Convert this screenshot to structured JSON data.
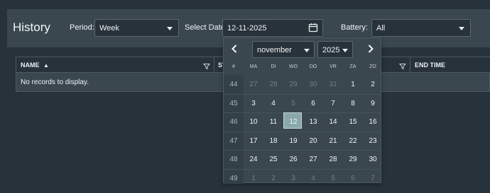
{
  "page": {
    "title": "History"
  },
  "filters": {
    "period_label": "Period:",
    "period_value": "Week",
    "date_label": "Select Date:",
    "date_value": "12-11-2025",
    "battery_label": "Battery:",
    "battery_value": "All"
  },
  "grid": {
    "columns": [
      "NAME",
      "ST",
      "END TIME"
    ],
    "empty_message": "No records to display."
  },
  "calendar": {
    "month": "november",
    "year": "2025",
    "week_header": "#",
    "weekdays": [
      "MA",
      "DI",
      "WO",
      "DO",
      "VR",
      "ZA",
      "ZO"
    ],
    "weeks": [
      {
        "number": "44",
        "days": [
          {
            "d": "27",
            "o": true
          },
          {
            "d": "28",
            "o": true
          },
          {
            "d": "29",
            "o": true
          },
          {
            "d": "30",
            "o": true
          },
          {
            "d": "31",
            "o": true
          },
          {
            "d": "1",
            "o": false
          },
          {
            "d": "2",
            "o": false
          }
        ]
      },
      {
        "number": "45",
        "days": [
          {
            "d": "3",
            "o": false
          },
          {
            "d": "4",
            "o": false
          },
          {
            "d": "5",
            "o": true
          },
          {
            "d": "6",
            "o": false
          },
          {
            "d": "7",
            "o": false
          },
          {
            "d": "8",
            "o": false
          },
          {
            "d": "9",
            "o": false
          }
        ]
      },
      {
        "number": "46",
        "days": [
          {
            "d": "10",
            "o": false
          },
          {
            "d": "11",
            "o": false
          },
          {
            "d": "12",
            "o": false
          },
          {
            "d": "13",
            "o": false
          },
          {
            "d": "14",
            "o": false
          },
          {
            "d": "15",
            "o": false
          },
          {
            "d": "16",
            "o": false
          }
        ]
      },
      {
        "number": "47",
        "days": [
          {
            "d": "17",
            "o": false
          },
          {
            "d": "18",
            "o": false
          },
          {
            "d": "19",
            "o": false
          },
          {
            "d": "20",
            "o": false
          },
          {
            "d": "21",
            "o": false
          },
          {
            "d": "22",
            "o": false
          },
          {
            "d": "23",
            "o": false
          }
        ]
      },
      {
        "number": "48",
        "days": [
          {
            "d": "24",
            "o": false
          },
          {
            "d": "25",
            "o": false
          },
          {
            "d": "26",
            "o": false
          },
          {
            "d": "27",
            "o": false
          },
          {
            "d": "28",
            "o": false
          },
          {
            "d": "29",
            "o": false
          },
          {
            "d": "30",
            "o": false
          }
        ]
      },
      {
        "number": "49",
        "days": [
          {
            "d": "1",
            "o": true
          },
          {
            "d": "2",
            "o": true
          },
          {
            "d": "3",
            "o": true
          },
          {
            "d": "4",
            "o": true
          },
          {
            "d": "5",
            "o": true
          },
          {
            "d": "6",
            "o": true
          },
          {
            "d": "7",
            "o": true
          }
        ]
      }
    ],
    "selected_day": "12"
  },
  "icons": {
    "prev": "chevron-left-icon",
    "next": "chevron-right-icon",
    "calendar": "calendar-icon",
    "filter": "filter-icon",
    "sort": "sort-asc-icon"
  }
}
